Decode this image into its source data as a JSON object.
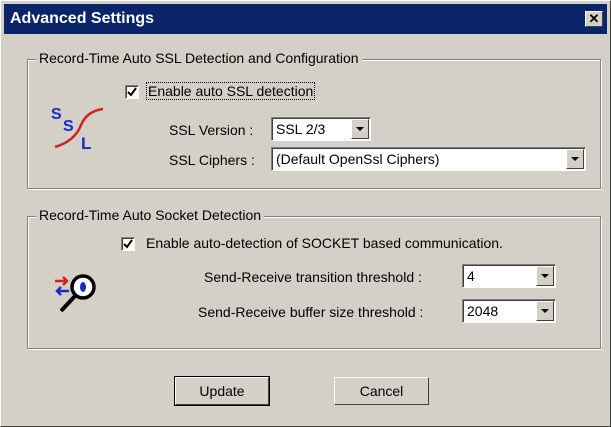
{
  "window": {
    "title": "Advanced Settings",
    "close_glyph": "✕"
  },
  "ssl_group": {
    "legend": "Record-Time Auto SSL Detection and Configuration",
    "icon": "ssl-icon",
    "icon_letters": [
      "S",
      "S",
      "L"
    ],
    "enable_checkbox": {
      "checked": true,
      "label": "Enable auto SSL detection"
    },
    "version": {
      "label": "SSL Version :",
      "value": "SSL 2/3"
    },
    "ciphers": {
      "label": "SSL Ciphers :",
      "value": "(Default OpenSsl Ciphers)"
    }
  },
  "socket_group": {
    "legend": "Record-Time Auto Socket Detection",
    "icon": "socket-detection-icon",
    "enable_checkbox": {
      "checked": true,
      "label": "Enable auto-detection of SOCKET based communication."
    },
    "transition_threshold": {
      "label": "Send-Receive transition threshold :",
      "value": "4"
    },
    "buffer_threshold": {
      "label": "Send-Receive buffer size threshold :",
      "value": "2048"
    }
  },
  "buttons": {
    "update": "Update",
    "cancel": "Cancel"
  },
  "colors": {
    "titlebar": "#0a246a",
    "dialog_bg": "#d4d0c8",
    "ssl_blue": "#1a28c8",
    "ssl_red": "#d02020"
  }
}
